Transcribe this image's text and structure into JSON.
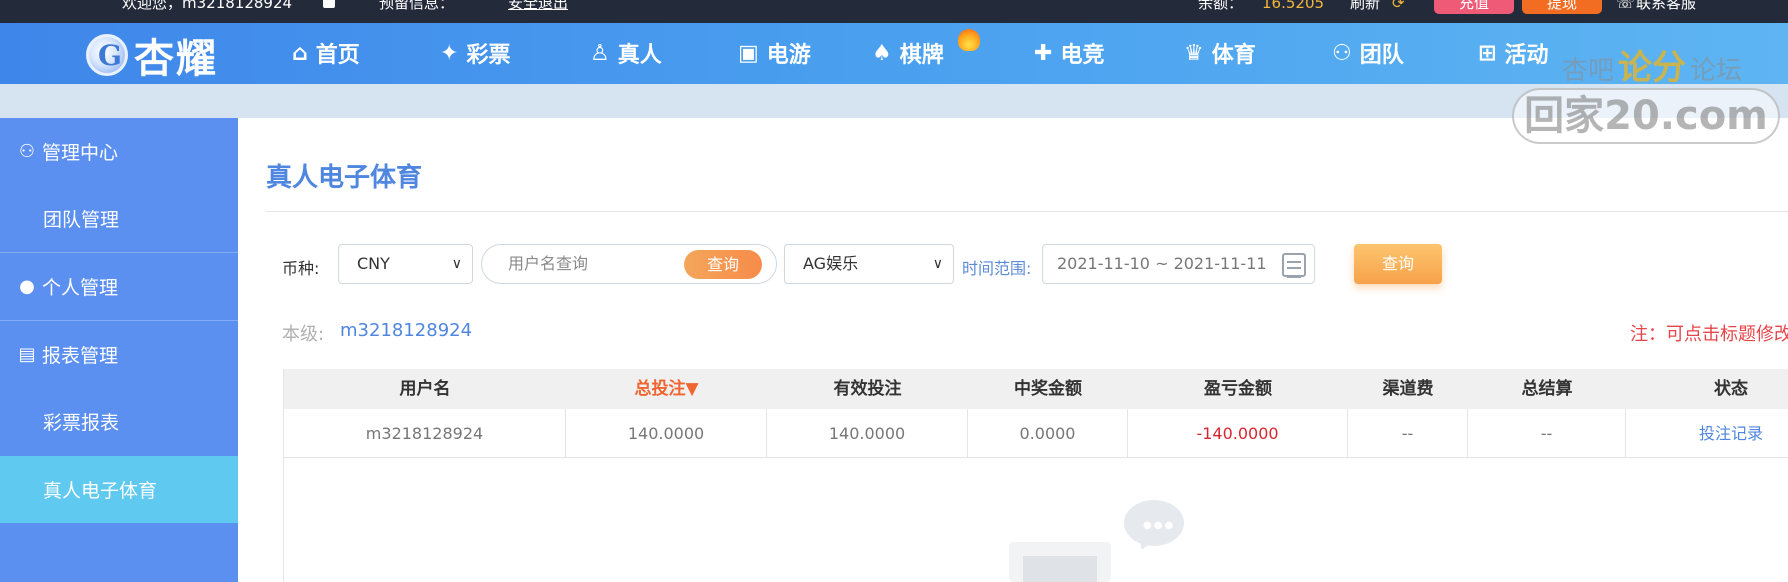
{
  "topbar": {
    "welcome": "欢迎您，m3218128924",
    "message": "预留信息：",
    "logout": "安全退出",
    "balance_label": "余额：",
    "balance_value": "16.5205",
    "refresh": "刷新",
    "recharge": "充值",
    "withdraw": "提现",
    "support": "联系客服"
  },
  "logo": {
    "text": "杏耀",
    "icon": "g-emblem-icon"
  },
  "nav": [
    {
      "label": "首页",
      "icon": "home-icon"
    },
    {
      "label": "彩票",
      "icon": "ticket-icon"
    },
    {
      "label": "真人",
      "icon": "dealer-icon"
    },
    {
      "label": "电游",
      "icon": "arcade-icon"
    },
    {
      "label": "棋牌",
      "icon": "cards-icon"
    },
    {
      "label": "电竞",
      "icon": "gamepad-icon"
    },
    {
      "label": "体育",
      "icon": "trophy-icon"
    },
    {
      "label": "团队",
      "icon": "team-icon"
    },
    {
      "label": "活动",
      "icon": "gift-icon"
    }
  ],
  "sidebar": [
    {
      "label": "管理中心",
      "type": "group",
      "icon": "users-icon"
    },
    {
      "label": "团队管理",
      "type": "sub"
    },
    {
      "label": "个人管理",
      "type": "group",
      "icon": "user-icon"
    },
    {
      "label": "报表管理",
      "type": "group",
      "icon": "report-icon"
    },
    {
      "label": "彩票报表",
      "type": "sub"
    },
    {
      "label": "真人电子体育",
      "type": "sub",
      "active": true
    }
  ],
  "page": {
    "title": "真人电子体育",
    "filters": {
      "currency_label": "币种:",
      "currency_value": "CNY",
      "username_placeholder": "用户名查询",
      "search_button": "查询",
      "platform_value": "AG娱乐",
      "time_label": "时间范围:",
      "date_range": "2021-11-10 ~ 2021-11-11",
      "query_button": "查询"
    },
    "level_label": "本级:",
    "level_value": "m3218128924",
    "note": "注：可点击标题修改排序"
  },
  "table": {
    "headers": [
      "用户名",
      "总投注▼",
      "有效投注",
      "中奖金额",
      "盈亏金额",
      "渠道费",
      "总结算",
      "状态"
    ],
    "rows": [
      [
        "m3218128924",
        "140.0000",
        "140.0000",
        "0.0000",
        "-140.0000",
        "--",
        "--",
        "投注记录"
      ]
    ]
  },
  "watermark": {
    "line1_left": "杏吧",
    "line1_mid": "论分",
    "line1_right": "论坛",
    "line2": "回家20.com"
  },
  "colors": {
    "nav_gradient_start": "#3f86ea",
    "sidebar": "#5b8ff0",
    "sidebar_active": "#5fc9ef",
    "accent_orange": "#f7a24a",
    "negative": "#d9262e",
    "link": "#4f86df"
  }
}
